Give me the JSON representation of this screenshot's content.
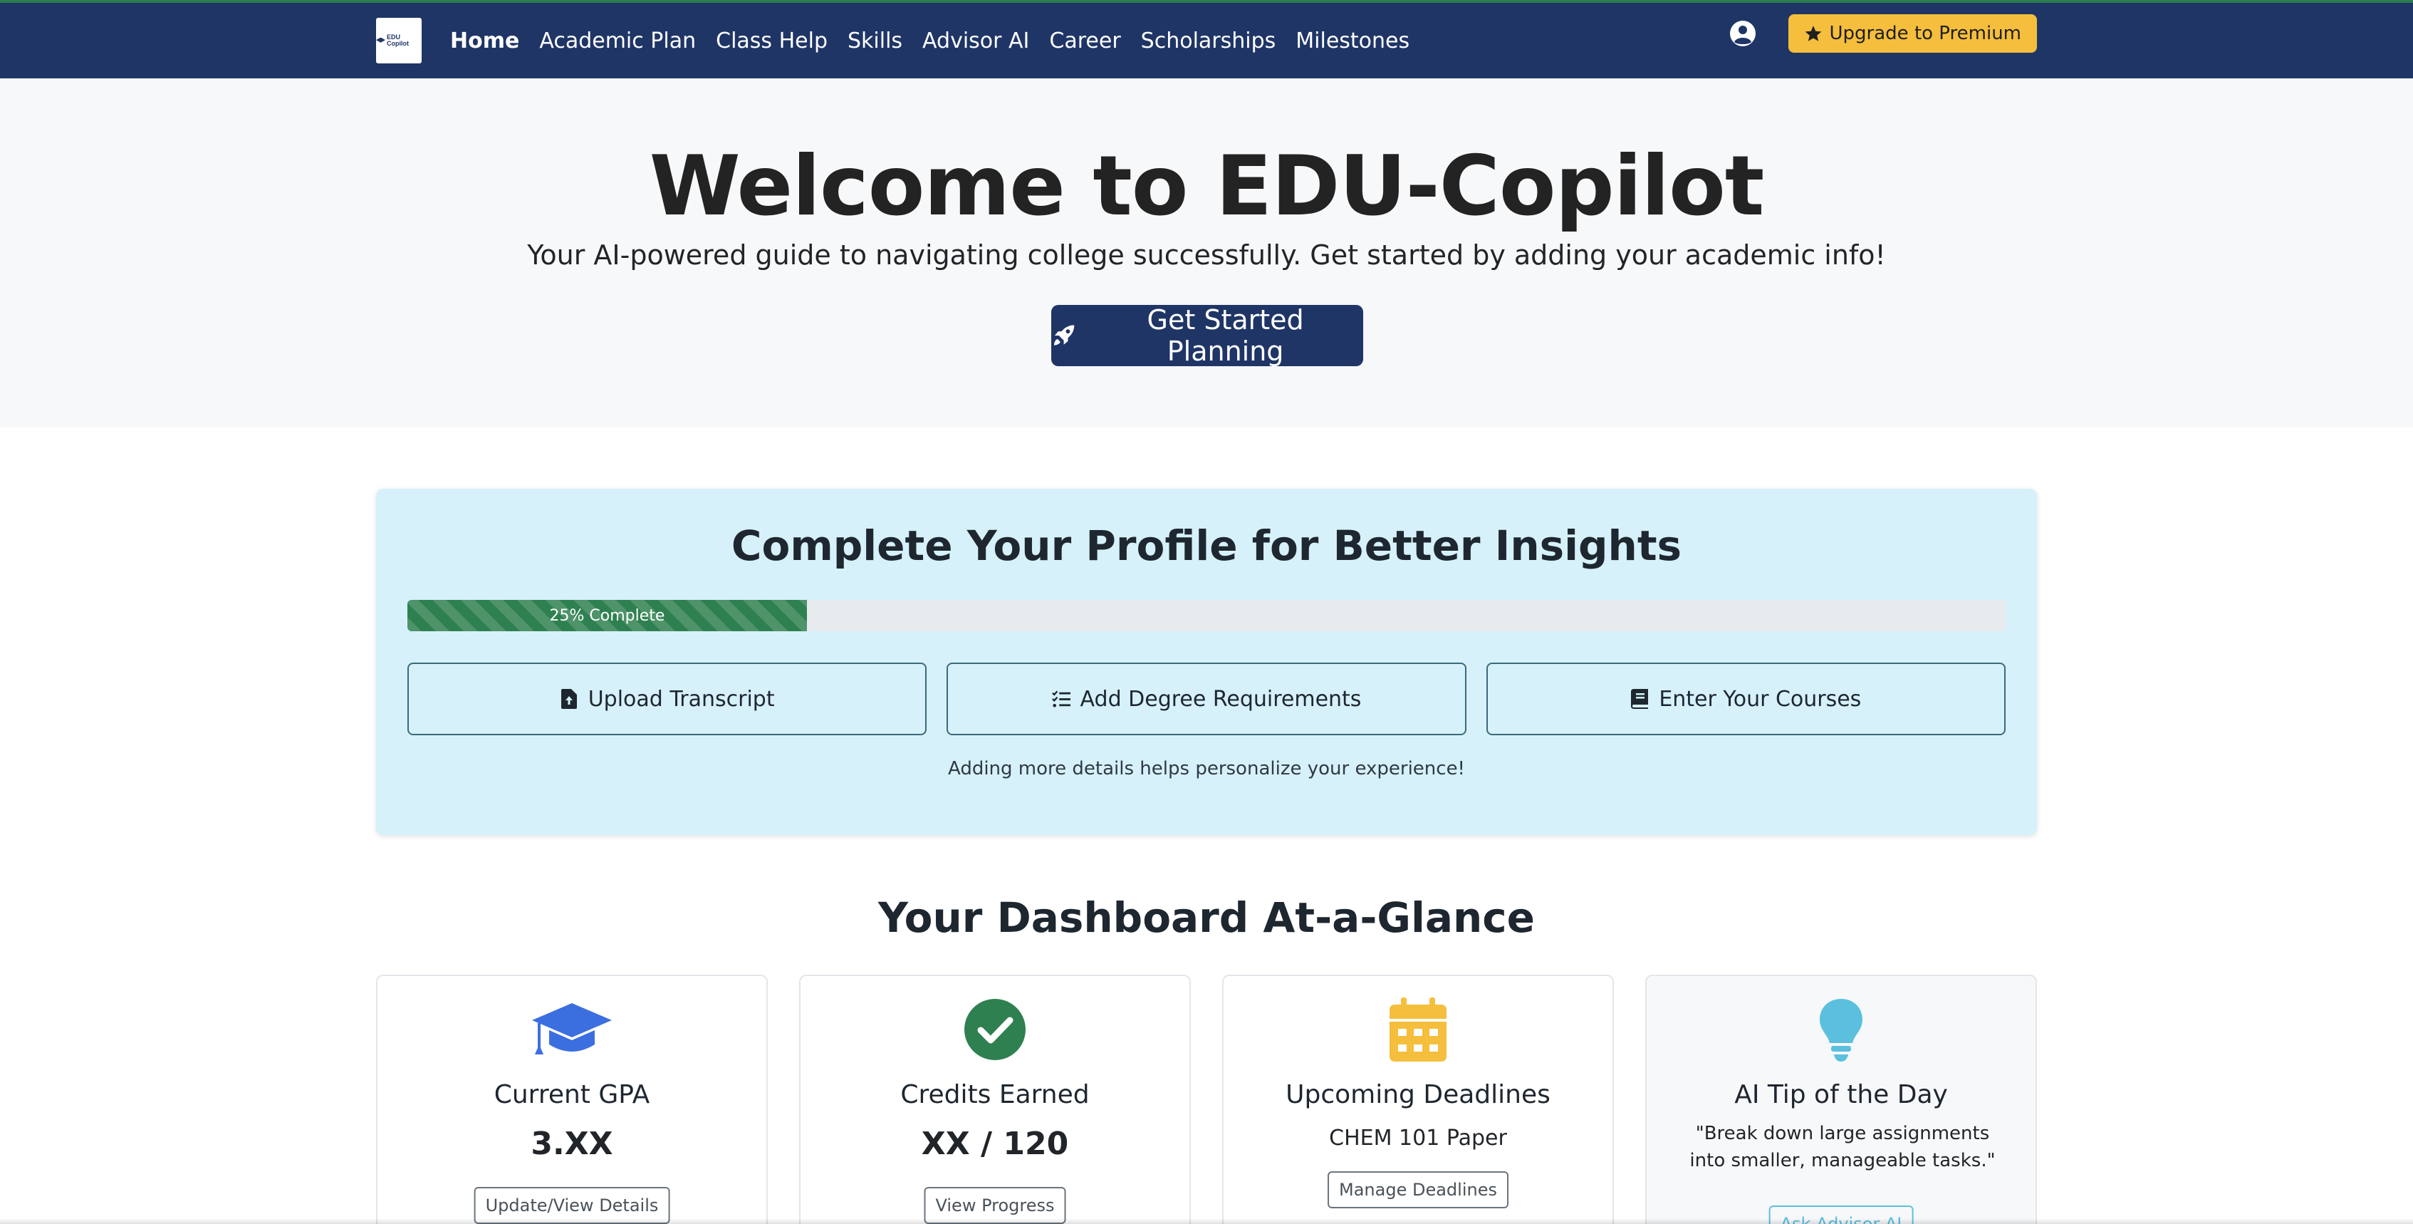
{
  "nav": {
    "brand_text": "EDU Copilot",
    "links": [
      {
        "label": "Home",
        "active": true
      },
      {
        "label": "Academic Plan"
      },
      {
        "label": "Class Help"
      },
      {
        "label": "Skills"
      },
      {
        "label": "Advisor AI"
      },
      {
        "label": "Career"
      },
      {
        "label": "Scholarships"
      },
      {
        "label": "Milestones"
      }
    ],
    "user_icon": "user-circle-icon",
    "premium_label": "Upgrade to Premium",
    "premium_icon": "star-icon"
  },
  "hero": {
    "title": "Welcome to EDU-Copilot",
    "subtitle": "Your AI-powered guide to navigating college successfully. Get started by adding your academic info!",
    "cta_label": "Get Started Planning",
    "cta_icon": "rocket-icon"
  },
  "profile": {
    "title": "Complete Your Profile for Better Insights",
    "progress_percent": 25,
    "progress_label": "25% Complete",
    "actions": [
      {
        "label": "Upload Transcript",
        "icon": "file-upload-icon"
      },
      {
        "label": "Add Degree Requirements",
        "icon": "list-check-icon"
      },
      {
        "label": "Enter Your Courses",
        "icon": "book-icon"
      }
    ],
    "note": "Adding more details helps personalize your experience!"
  },
  "dashboard": {
    "title": "Your Dashboard At-a-Glance",
    "cards": [
      {
        "icon": "graduation-cap-icon",
        "title": "Current GPA",
        "value": "3.XX",
        "button": "Update/View Details"
      },
      {
        "icon": "check-circle-icon",
        "title": "Credits Earned",
        "value": "XX / 120",
        "button": "View Progress"
      },
      {
        "icon": "calendar-icon",
        "title": "Upcoming Deadlines",
        "text": "CHEM 101 Paper",
        "button": "Manage Deadlines"
      },
      {
        "icon": "lightbulb-icon",
        "title": "AI Tip of the Day",
        "quote": "\"Break down large assignments into smaller, manageable tasks.\"",
        "button": "Ask Advisor AI"
      }
    ]
  },
  "colors": {
    "navbar": "#1f3566",
    "premium": "#f5be3c",
    "progress": "#2f8050",
    "profile_bg": "#d6f1f9",
    "gpa_icon": "#3b6fe0",
    "credits_icon": "#2f8050",
    "deadlines_icon": "#f5be3c",
    "tip_icon": "#5bc0de"
  }
}
